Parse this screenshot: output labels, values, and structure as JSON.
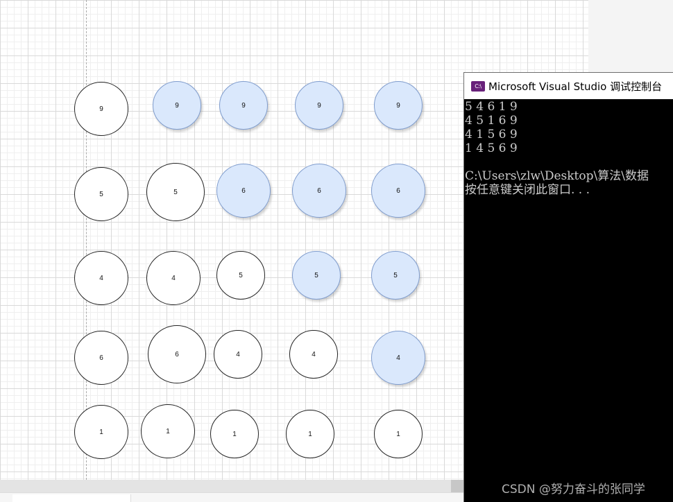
{
  "canvas": {
    "columns": [
      {
        "nodes": [
          "9",
          "5",
          "4",
          "6",
          "1"
        ],
        "highlighted": [
          false,
          false,
          false,
          false,
          false
        ]
      },
      {
        "nodes": [
          "9",
          "5",
          "4",
          "6",
          "1"
        ],
        "highlighted": [
          true,
          false,
          false,
          false,
          false
        ]
      },
      {
        "nodes": [
          "9",
          "6",
          "5",
          "4",
          "1"
        ],
        "highlighted": [
          true,
          true,
          false,
          false,
          false
        ]
      },
      {
        "nodes": [
          "9",
          "6",
          "5",
          "4",
          "1"
        ],
        "highlighted": [
          true,
          true,
          true,
          false,
          false
        ]
      },
      {
        "nodes": [
          "9",
          "6",
          "5",
          "4",
          "1"
        ],
        "highlighted": [
          true,
          true,
          true,
          true,
          false
        ]
      }
    ],
    "colors": {
      "highlight_fill": "#dae8fc",
      "highlight_stroke": "#7f9ccd",
      "node_stroke": "#222222"
    }
  },
  "console": {
    "title": "Microsoft Visual Studio 调试控制台",
    "icon": "visual-studio-icon",
    "icon_text": "C:\\",
    "lines": [
      "5 4 6 1 9",
      "4 5 1 6 9",
      "4 1 5 6 9",
      "1 4 5 6 9",
      "",
      "C:\\Users\\zlw\\Desktop\\算法\\数据",
      "按任意键关闭此窗口. . ."
    ]
  },
  "watermark": "CSDN @努力奋斗的张同学"
}
